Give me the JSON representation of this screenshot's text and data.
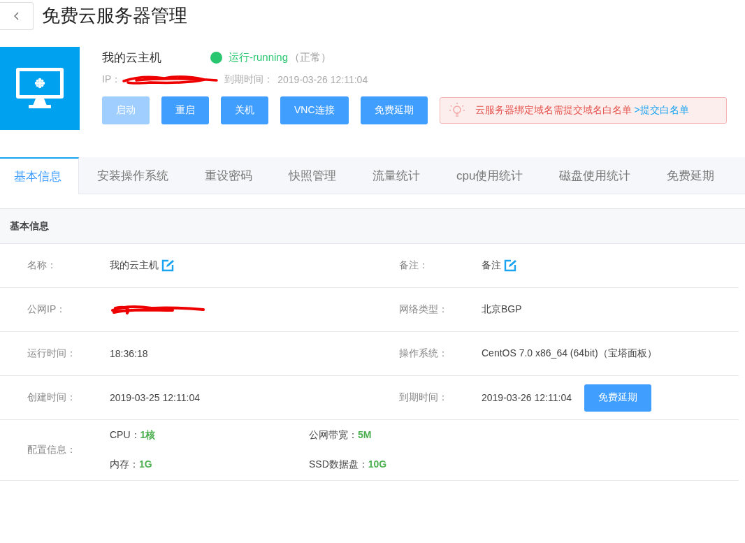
{
  "header": {
    "title": "免费云服务器管理"
  },
  "server": {
    "name": "我的云主机",
    "running": true,
    "status": "运行-running",
    "status_note": "（正常）",
    "ip_label": "IP：",
    "ip_redacted": true,
    "expiry_label": "到期时间：",
    "expiry": "2019-03-26 12:11:04"
  },
  "buttons": [
    {
      "label": "启动",
      "disabled": true
    },
    {
      "label": "重启",
      "disabled": false
    },
    {
      "label": "关机",
      "disabled": false
    },
    {
      "label": "VNC连接",
      "disabled": false
    },
    {
      "label": "免费延期",
      "disabled": false
    }
  ],
  "notice": {
    "text": "云服务器绑定域名需提交域名白名单",
    "link": ">提交白名单"
  },
  "tabs": [
    {
      "label": "基本信息",
      "selected": true
    },
    {
      "label": "安装操作系统",
      "selected": false
    },
    {
      "label": "重设密码",
      "selected": false
    },
    {
      "label": "快照管理",
      "selected": false
    },
    {
      "label": "流量统计",
      "selected": false
    },
    {
      "label": "cpu使用统计",
      "selected": false
    },
    {
      "label": "磁盘使用统计",
      "selected": false
    },
    {
      "label": "免费延期",
      "selected": false
    }
  ],
  "section_title": "基本信息",
  "info_rows": [
    {
      "fields": [
        {
          "label": "名称：",
          "value": "我的云主机",
          "editable": true,
          "redacted": false
        },
        {
          "label": "备注：",
          "value": "备注",
          "editable": true,
          "redacted": false
        }
      ]
    },
    {
      "fields": [
        {
          "label": "公网IP：",
          "editable": false,
          "redacted": true
        },
        {
          "label": "网络类型：",
          "value": "北京BGP",
          "editable": false,
          "redacted": false
        }
      ]
    },
    {
      "fields": [
        {
          "label": "运行时间：",
          "value": "18:36:18",
          "editable": false,
          "redacted": false
        },
        {
          "label": "操作系统：",
          "value": "CentOS 7.0 x86_64 (64bit)（宝塔面板）",
          "editable": false,
          "redacted": false
        }
      ]
    },
    {
      "fields": [
        {
          "label": "创建时间：",
          "value": "2019-03-25 12:11:04",
          "editable": false,
          "redacted": false
        },
        {
          "label": "到期时间：",
          "value": "2019-03-26 12:11:04",
          "editable": false,
          "redacted": false,
          "action": "免费延期"
        }
      ]
    }
  ],
  "config": {
    "label": "配置信息：",
    "items": [
      {
        "name": "CPU：",
        "value": "1核"
      },
      {
        "name": "公网带宽：",
        "value": "5M"
      },
      {
        "name": "内存：",
        "value": "1G"
      },
      {
        "name": "SSD数据盘：",
        "value": "10G"
      }
    ]
  }
}
